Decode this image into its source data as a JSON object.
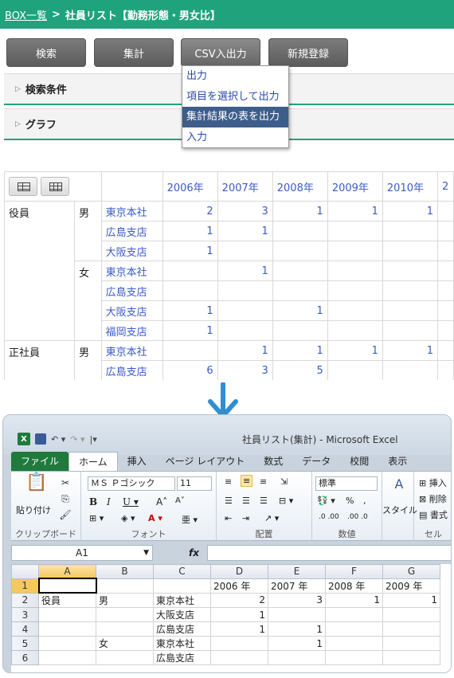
{
  "app": {
    "breadcrumb_link": "BOX一覧",
    "breadcrumb_sep": ">",
    "page_title": "社員リスト【勤務形態・男女比】",
    "accent": "#1fa37c"
  },
  "toolbar": {
    "search": "検索",
    "aggregate": "集計",
    "csv": "CSV入出力",
    "new": "新規登録"
  },
  "csv_menu": {
    "items": [
      "出力",
      "項目を選択して出力",
      "集計結果の表を出力",
      "入力"
    ],
    "selected_index": 2
  },
  "sections": {
    "search_conditions": "検索条件",
    "graph": "グラフ"
  },
  "table": {
    "years": [
      "2006年",
      "2007年",
      "2008年",
      "2009年",
      "2010年",
      "2"
    ],
    "rows": [
      {
        "group": "役員",
        "sex": "男",
        "office": "東京本社",
        "vals": [
          "2",
          "3",
          "1",
          "1",
          "1",
          ""
        ]
      },
      {
        "group": "",
        "sex": "",
        "office": "広島支店",
        "vals": [
          "1",
          "1",
          "",
          "",
          "",
          ""
        ]
      },
      {
        "group": "",
        "sex": "",
        "office": "大阪支店",
        "vals": [
          "1",
          "",
          "",
          "",
          "",
          ""
        ]
      },
      {
        "group": "",
        "sex": "女",
        "office": "東京本社",
        "vals": [
          "",
          "1",
          "",
          "",
          "",
          ""
        ]
      },
      {
        "group": "",
        "sex": "",
        "office": "広島支店",
        "vals": [
          "",
          "",
          "",
          "",
          "",
          ""
        ]
      },
      {
        "group": "",
        "sex": "",
        "office": "大阪支店",
        "vals": [
          "1",
          "",
          "1",
          "",
          "",
          ""
        ]
      },
      {
        "group": "",
        "sex": "",
        "office": "福岡支店",
        "vals": [
          "1",
          "",
          "",
          "",
          "",
          ""
        ]
      },
      {
        "group": "正社員",
        "sex": "男",
        "office": "東京本社",
        "vals": [
          "",
          "1",
          "1",
          "1",
          "1",
          ""
        ]
      },
      {
        "group": "",
        "sex": "",
        "office": "広島支店",
        "vals": [
          "6",
          "3",
          "5",
          "",
          "",
          ""
        ]
      }
    ]
  },
  "excel": {
    "window_title": "社員リスト(集計) - Microsoft Excel",
    "tabs": [
      "ファイル",
      "ホーム",
      "挿入",
      "ページ レイアウト",
      "数式",
      "データ",
      "校閲",
      "表示"
    ],
    "ribbon": {
      "clipboard": "クリップボード",
      "paste": "貼り付け",
      "font_group": "フォント",
      "font_name": "ＭＳ Ｐゴシック",
      "font_size": "11",
      "align_group": "配置",
      "number_group": "数値",
      "number_format": "標準",
      "style": "スタイル",
      "cell_group": "セル",
      "insert": "挿入",
      "delete": "削除",
      "format": "書式"
    },
    "name_box": "A1",
    "fx": "fx",
    "columns": [
      "A",
      "B",
      "C",
      "D",
      "E",
      "F",
      "G"
    ],
    "rows": [
      {
        "n": "1",
        "cells": [
          "",
          "",
          "",
          "2006 年",
          "2007 年",
          "2008 年",
          "2009 年"
        ]
      },
      {
        "n": "2",
        "cells": [
          "役員",
          "男",
          "東京本社",
          "2",
          "3",
          "1",
          "1"
        ]
      },
      {
        "n": "3",
        "cells": [
          "",
          "",
          "大阪支店",
          "1",
          "",
          "",
          ""
        ]
      },
      {
        "n": "4",
        "cells": [
          "",
          "",
          "広島支店",
          "1",
          "1",
          "",
          ""
        ]
      },
      {
        "n": "5",
        "cells": [
          "",
          "女",
          "東京本社",
          "",
          "1",
          "",
          ""
        ]
      },
      {
        "n": "6",
        "cells": [
          "",
          "",
          "広島支店",
          "",
          "",
          "",
          ""
        ]
      }
    ]
  }
}
